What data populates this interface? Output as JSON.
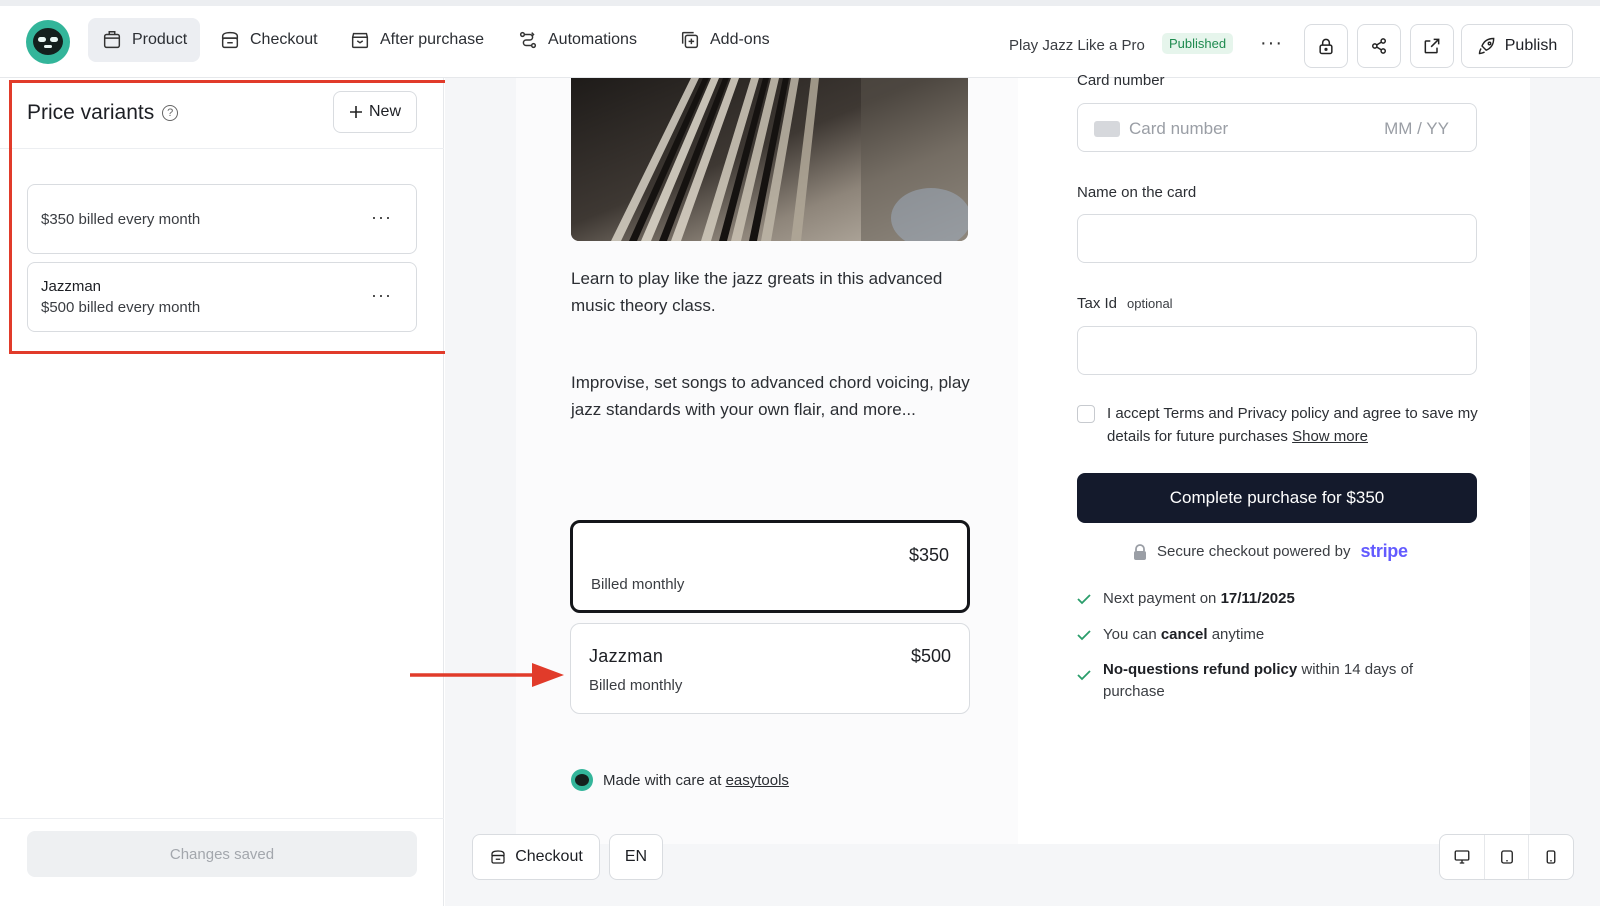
{
  "nav": {
    "tabs": [
      {
        "label": "Product",
        "icon": "box-icon"
      },
      {
        "label": "Checkout",
        "icon": "checkout-icon"
      },
      {
        "label": "After purchase",
        "icon": "package-icon"
      },
      {
        "label": "Automations",
        "icon": "automation-icon"
      },
      {
        "label": "Add-ons",
        "icon": "addon-icon"
      }
    ],
    "product_title": "Play Jazz Like a Pro",
    "status_badge": "Published",
    "more": "···",
    "publish_label": "Publish"
  },
  "left_panel": {
    "title": "Price variants",
    "help": "?",
    "new_label": "New",
    "variants": [
      {
        "name": "",
        "price": "$350 billed every month"
      },
      {
        "name": "Jazzman",
        "price": "$500 billed every month"
      }
    ],
    "variant_menu": "···",
    "changes_saved": "Changes saved"
  },
  "preview": {
    "description_1": "Learn to play like the jazz greats in this advanced music theory class.",
    "description_2": "Improvise, set songs to advanced chord voicing, play jazz standards with your own flair, and more...",
    "price_options": [
      {
        "name": "",
        "price": "$350",
        "billing": "Billed monthly",
        "selected": true
      },
      {
        "name": "Jazzman",
        "price": "$500",
        "billing": "Billed monthly",
        "selected": false
      }
    ],
    "made_with_prefix": "Made with care at ",
    "made_with_link": "easytools"
  },
  "checkout_form": {
    "card_number_label": "Card number",
    "card_number_placeholder": "Card number",
    "expiry_placeholder": "MM / YY",
    "name_label": "Name on the card",
    "tax_label": "Tax Id",
    "tax_optional": "optional",
    "terms_text": "I accept Terms and Privacy policy and agree to save my details for future purchases ",
    "terms_link": "Show more",
    "complete_label": "Complete purchase for $350",
    "secure_text": "Secure checkout powered by",
    "stripe_brand": "stripe",
    "next_payment_prefix": "Next payment on ",
    "next_payment_date": "17/11/2025",
    "cancel_prefix": "You can ",
    "cancel_bold": "cancel",
    "cancel_suffix": " anytime",
    "refund_bold": "No-questions refund policy",
    "refund_suffix": " within 14 days of purchase"
  },
  "bottom_toolbar": {
    "checkout_label": "Checkout",
    "language": "EN"
  },
  "colors": {
    "accent_green": "#33b59a",
    "highlight_red": "#e13b2a",
    "primary_button": "#141a2c",
    "stripe_purple": "#635bff",
    "published_green": "#1e8a4f"
  }
}
